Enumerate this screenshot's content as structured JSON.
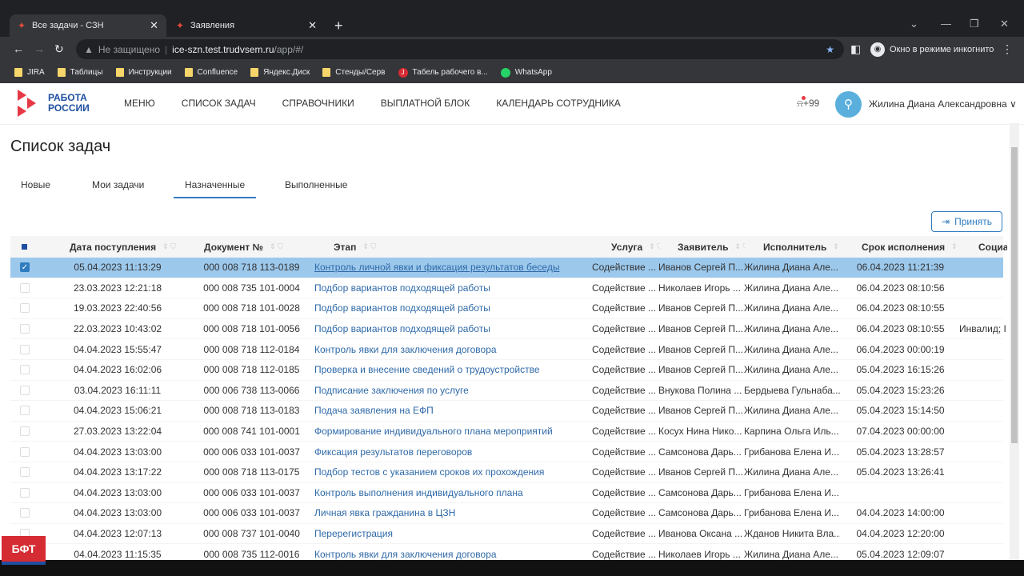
{
  "browser": {
    "tabs": [
      {
        "label": "Все задачи - СЗН"
      },
      {
        "label": "Заявления"
      }
    ],
    "security": "Не защищено",
    "url_host": "ice-szn.test.trudvsem.ru",
    "url_path": "/app/#/",
    "incognito": "Окно в режиме инкогнито",
    "bookmarks": [
      "JIRA",
      "Таблицы",
      "Инструкции",
      "Confluence",
      "Яндекс.Диск",
      "Стенды/Серв",
      "Табель рабочего в...",
      "WhatsApp"
    ]
  },
  "header": {
    "logo_line1": "РАБОТА",
    "logo_line2": "РОССИИ",
    "menu": [
      "МЕНЮ",
      "СПИСОК ЗАДАЧ",
      "СПРАВОЧНИКИ",
      "ВЫПЛАТНОЙ БЛОК",
      "КАЛЕНДАРЬ СОТРУДНИКА"
    ],
    "notifications": "+99",
    "user": "Жилина Диана Александровна"
  },
  "page_title": "Список задач",
  "tabs": [
    "Новые",
    "Мои задачи",
    "Назначенные",
    "Выполненные"
  ],
  "accept_label": "Принять",
  "columns": [
    "Дата поступления",
    "Документ №",
    "Этап",
    "Услуга",
    "Заявитель",
    "Исполнитель",
    "Срок исполнения",
    "Социа"
  ],
  "rows": [
    [
      "05.04.2023 11:13:29",
      "000 008 718 113-0189",
      "Контроль личной явки и фиксация результатов беседы",
      "Содействие ...",
      "Иванов Сергей П...",
      "Жилина Диана Але...",
      "06.04.2023 11:21:39",
      ""
    ],
    [
      "23.03.2023 12:21:18",
      "000 008 735 101-0004",
      "Подбор вариантов подходящей работы",
      "Содействие ...",
      "Николаев Игорь ...",
      "Жилина Диана Але...",
      "06.04.2023 08:10:56",
      ""
    ],
    [
      "19.03.2023 22:40:56",
      "000 008 718 101-0028",
      "Подбор вариантов подходящей работы",
      "Содействие ...",
      "Иванов Сергей П...",
      "Жилина Диана Але...",
      "06.04.2023 08:10:55",
      ""
    ],
    [
      "22.03.2023 10:43:02",
      "000 008 718 101-0056",
      "Подбор вариантов подходящей работы",
      "Содействие ...",
      "Иванов Сергей П...",
      "Жилина Диана Але...",
      "06.04.2023 08:10:55",
      "Инвалид; I"
    ],
    [
      "04.04.2023 15:55:47",
      "000 008 718 112-0184",
      "Контроль явки для заключения договора",
      "Содействие ...",
      "Иванов Сергей П...",
      "Жилина Диана Але...",
      "06.04.2023 00:00:19",
      ""
    ],
    [
      "04.04.2023 16:02:06",
      "000 008 718 112-0185",
      "Проверка и внесение сведений о трудоустройстве",
      "Содействие ...",
      "Иванов Сергей П...",
      "Жилина Диана Але...",
      "05.04.2023 16:15:26",
      ""
    ],
    [
      "03.04.2023 16:11:11",
      "000 006 738 113-0066",
      "Подписание заключения по услуге",
      "Содействие ...",
      "Внукова Полина ...",
      "Бердыева Гульнаба...",
      "05.04.2023 15:23:26",
      ""
    ],
    [
      "04.04.2023 15:06:21",
      "000 008 718 113-0183",
      "Подача заявления на ЕФП",
      "Содействие ...",
      "Иванов Сергей П...",
      "Жилина Диана Але...",
      "05.04.2023 15:14:50",
      ""
    ],
    [
      "27.03.2023 13:22:04",
      "000 008 741 101-0001",
      "Формирование индивидуального плана мероприятий",
      "Содействие ...",
      "Косух Нина Нико...",
      "Карпина Ольга Иль...",
      "07.04.2023 00:00:00",
      ""
    ],
    [
      "04.04.2023 13:03:00",
      "000 006 033 101-0037",
      "Фиксация результатов переговоров",
      "Содействие ...",
      "Самсонова Дарь...",
      "Грибанова Елена И...",
      "05.04.2023 13:28:57",
      ""
    ],
    [
      "04.04.2023 13:17:22",
      "000 008 718 113-0175",
      "Подбор тестов с указанием сроков их прохождения",
      "Содействие ...",
      "Иванов Сергей П...",
      "Жилина Диана Але...",
      "05.04.2023 13:26:41",
      ""
    ],
    [
      "04.04.2023 13:03:00",
      "000 006 033 101-0037",
      "Контроль выполнения индивидуального плана",
      "Содействие ...",
      "Самсонова Дарь...",
      "Грибанова Елена И...",
      "",
      ""
    ],
    [
      "04.04.2023 13:03:00",
      "000 006 033 101-0037",
      "Личная явка гражданина в ЦЗН",
      "Содействие ...",
      "Самсонова Дарь...",
      "Грибанова Елена И...",
      "04.04.2023 14:00:00",
      ""
    ],
    [
      "04.04.2023 12:07:13",
      "000 008 737 101-0040",
      "Перерегистрация",
      "Содействие ...",
      "Иванова Оксана ...",
      "Жданов Никита Вла...",
      "04.04.2023 12:20:00",
      ""
    ],
    [
      "04.04.2023 11:15:35",
      "000 008 735 112-0016",
      "Контроль явки для заключения договора",
      "Содействие ...",
      "Николаев Игорь ...",
      "Жилина Диана Але...",
      "05.04.2023 12:09:07",
      ""
    ]
  ],
  "selected_row": 0,
  "corner_badge": "БФТ"
}
